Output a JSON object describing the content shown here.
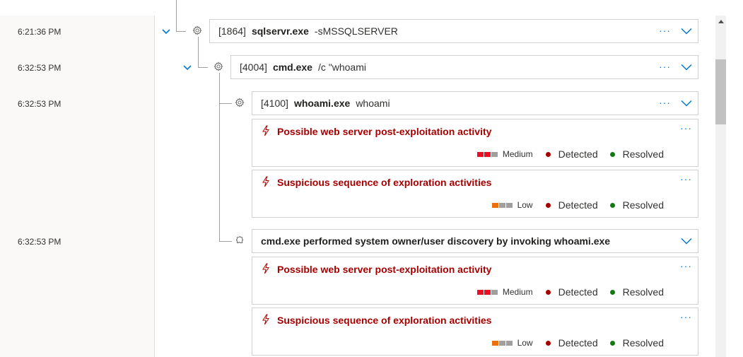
{
  "timeline": {
    "times": [
      "6:21:36 PM",
      "6:32:53 PM",
      "6:32:53 PM",
      "6:32:53 PM"
    ]
  },
  "processes": [
    {
      "pid": "[1864]",
      "name": "sqlservr.exe",
      "args": "-sMSSQLSERVER",
      "more": "···"
    },
    {
      "pid": "[4004]",
      "name": "cmd.exe",
      "args": "/c \"whoami",
      "more": "···"
    },
    {
      "pid": "[4100]",
      "name": "whoami.exe",
      "args": "whoami",
      "more": "···"
    }
  ],
  "event": {
    "title": "cmd.exe performed system owner/user discovery by invoking whoami.exe"
  },
  "alerts": [
    {
      "title": "Possible web server post-exploitation activity",
      "severity": "Medium",
      "detection": "Detected",
      "status": "Resolved",
      "more": "···"
    },
    {
      "title": "Suspicious sequence of exploration activities",
      "severity": "Low",
      "detection": "Detected",
      "status": "Resolved",
      "more": "···"
    },
    {
      "title": "Possible web server post-exploitation activity",
      "severity": "Medium",
      "detection": "Detected",
      "status": "Resolved",
      "more": "···"
    },
    {
      "title": "Suspicious sequence of exploration activities",
      "severity": "Low",
      "detection": "Detected",
      "status": "Resolved",
      "more": "···"
    }
  ],
  "colors": {
    "alert_title": "#a80000",
    "severity_high_fill": "#e81123",
    "severity_low_fill": "#ea700b",
    "severity_empty": "#a19f9d",
    "detected_dot": "#a80000",
    "resolved_dot": "#107c10",
    "accent": "#0078d4"
  },
  "icons": {
    "process": "gear-icon",
    "event": "puzzle-icon",
    "alert": "lightning-bolt-icon",
    "expand": "chevron-down-icon",
    "more": "more-options-icon"
  }
}
